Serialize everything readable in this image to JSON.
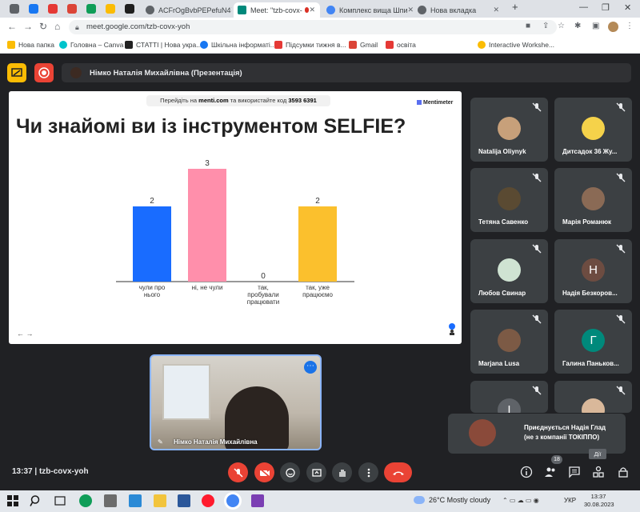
{
  "browser": {
    "tabs": [
      {
        "label": "",
        "color": "#5f6368"
      },
      {
        "label": "",
        "color": "#1877f2"
      },
      {
        "label": "",
        "color": "#e53935"
      },
      {
        "label": "",
        "color": "#db4437"
      },
      {
        "label": "",
        "color": "#0f9d58"
      },
      {
        "label": "",
        "color": "#fbbc04"
      },
      {
        "label": "",
        "color": "#1f1f1f"
      },
      {
        "label": "ACFrOgBvbPEPefuN4",
        "color": "#5f6368"
      },
      {
        "label": "Meet: \"tzb-covx-",
        "color": "#00897b"
      },
      {
        "label": "Комплекс вища Шпи",
        "color": "#4285f4"
      },
      {
        "label": "Нова вкладка",
        "color": "#5f6368"
      }
    ],
    "url": "meet.google.com/tzb-covx-yoh",
    "bookmarks": [
      {
        "label": "Нова папка",
        "color": "#fbbc04"
      },
      {
        "label": "Головна – Canva",
        "color": "#00c4cc"
      },
      {
        "label": "СТАТТІ | Нова укра...",
        "color": "#222222"
      },
      {
        "label": "Шкільна інформаті...",
        "color": "#1877f2"
      },
      {
        "label": "Підсумки тижня в...",
        "color": "#e53935"
      },
      {
        "label": "Gmail",
        "color": "#db4437"
      },
      {
        "label": "освіта",
        "color": "#e53935"
      },
      {
        "label": "Interactive Workshe...",
        "color": "#fbbc04"
      }
    ]
  },
  "meet": {
    "presenter_label": "Німко Наталія Михайлівна (Презентація)",
    "meeting_code": "tzb-covx-yoh",
    "time": "13:37",
    "participant_count": "18",
    "actions_tooltip": "Дії",
    "self_name": "Німко Наталія Михайлівна",
    "participants": [
      {
        "name": "Natalija Oliynyk",
        "avatar": "photo",
        "color": "#c7a07a"
      },
      {
        "name": "Дитсадок 36 Жу...",
        "avatar": "photo",
        "color": "#f5d24a"
      },
      {
        "name": "Тетяна Савенко",
        "avatar": "photo",
        "color": "#5a4a32"
      },
      {
        "name": "Марія Романюк",
        "avatar": "photo",
        "color": "#8a6a55"
      },
      {
        "name": "Любов Свинар",
        "avatar": "photo",
        "color": "#cfe3d2"
      },
      {
        "name": "Надія Безкоров...",
        "avatar": "Н",
        "color": "#6d4c41"
      },
      {
        "name": "Marjana Lusa",
        "avatar": "photo",
        "color": "#7c5a45"
      },
      {
        "name": "Галина Паньков...",
        "avatar": "Г",
        "color": "#00897b"
      },
      {
        "name": "",
        "avatar": "І",
        "color": "#5f6368"
      },
      {
        "name": "",
        "avatar": "photo",
        "color": "#d9b89a"
      }
    ],
    "toast": {
      "line1": "Приєднується Надія Глад",
      "line2": "(не з компанії ТОКІППО)"
    }
  },
  "slide": {
    "code_prefix": "Перейдіть на",
    "code_site": "menti.com",
    "code_mid": "та використайте код",
    "code": "3593 6391",
    "brand": "Mentimeter",
    "title": "Чи знайомі ви із інструментом SELFIE?",
    "footer_nav": "←  →"
  },
  "chart_data": {
    "type": "bar",
    "title": "Чи знайомі ви із інструментом SELFIE?",
    "categories": [
      "чули про нього",
      "ні, не чули",
      "так, пробували працювати",
      "так, уже працюємо"
    ],
    "category_lines": [
      [
        "чули про",
        "нього"
      ],
      [
        "ні, не чули"
      ],
      [
        "так,",
        "пробували",
        "працювати"
      ],
      [
        "так, уже",
        "працюємо"
      ]
    ],
    "values": [
      2,
      3,
      0,
      2
    ],
    "colors": [
      "#196cff",
      "#ff8fab",
      "#3a3a3a",
      "#fbc02d"
    ],
    "ylim": [
      0,
      3
    ],
    "grid": false,
    "legend": "none"
  },
  "taskbar": {
    "weather": "26°C  Mostly cloudy",
    "language": "УКР",
    "time": "13:37",
    "date": "30.08.2023"
  }
}
